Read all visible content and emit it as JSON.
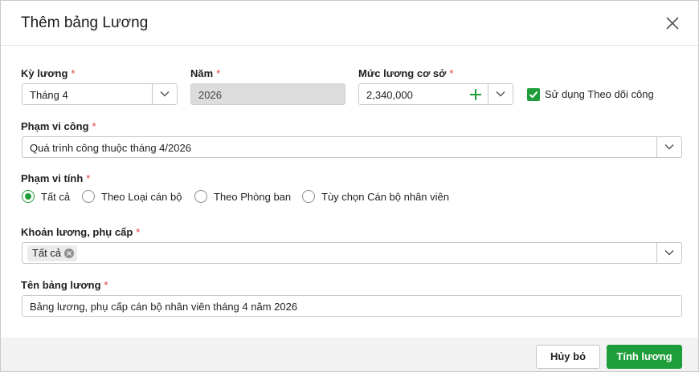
{
  "dialog": {
    "title": "Thêm bảng Lương"
  },
  "form": {
    "ky_luong": {
      "label": "Kỳ lương",
      "value": "Tháng 4"
    },
    "nam": {
      "label": "Năm",
      "value": "2026"
    },
    "muc_luong": {
      "label": "Mức lương cơ sở",
      "value": "2,340,000"
    },
    "theo_doi_cong": {
      "label": "Sử dụng Theo dõi công",
      "checked": true
    },
    "pham_vi_cong": {
      "label": "Phạm vi công",
      "value": "Quá trình công thuộc tháng 4/2026"
    },
    "pham_vi_tinh": {
      "label": "Phạm vi tính",
      "options": [
        "Tất cả",
        "Theo Loại cán bộ",
        "Theo Phòng ban",
        "Tùy chọn Cán bộ nhân viên"
      ],
      "selected": 0
    },
    "khoan_luong": {
      "label": "Khoản lương, phụ cấp",
      "chips": [
        "Tất cả"
      ]
    },
    "ten_bang": {
      "label": "Tên bảng lương",
      "value": "Bảng lương, phụ cấp cán bộ nhân viên tháng 4 năm 2026"
    },
    "required_mark": "*"
  },
  "footer": {
    "cancel_label": "Hủy bỏ",
    "submit_label": "Tính lương"
  },
  "colors": {
    "accent": "#1e9e3a",
    "required": "#e53935"
  },
  "icons": [
    "close-icon",
    "chevron-down-icon",
    "plus-icon",
    "check-icon",
    "chip-remove-icon"
  ]
}
